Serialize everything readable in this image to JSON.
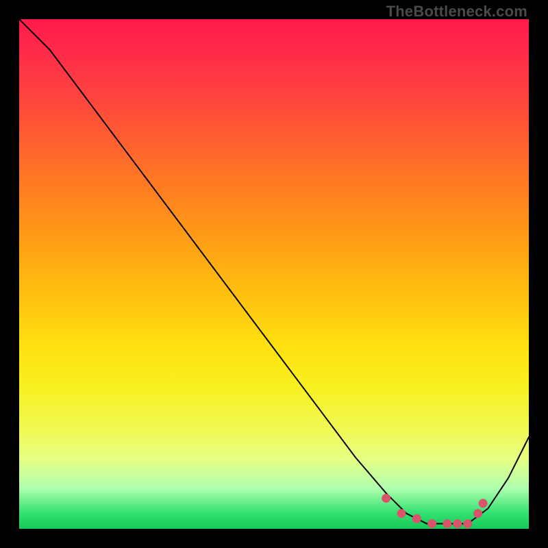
{
  "watermark": "TheBottleneck.com",
  "chart_data": {
    "type": "line",
    "title": "",
    "xlabel": "",
    "ylabel": "",
    "xlim": [
      0,
      100
    ],
    "ylim": [
      0,
      100
    ],
    "series": [
      {
        "name": "curve",
        "x": [
          0,
          6,
          12,
          18,
          24,
          30,
          36,
          42,
          48,
          54,
          60,
          66,
          72,
          76,
          80,
          84,
          88,
          92,
          96,
          100
        ],
        "y": [
          100,
          94,
          86,
          78,
          70,
          62,
          54,
          46,
          38,
          30,
          22,
          14,
          7,
          3,
          1,
          1,
          1,
          4,
          10,
          18
        ]
      }
    ],
    "markers": {
      "name": "highlight",
      "x": [
        72,
        75,
        78,
        81,
        84,
        86,
        88,
        90,
        91
      ],
      "y": [
        6,
        3,
        2,
        1,
        1,
        1,
        1,
        3,
        5
      ]
    }
  },
  "colors": {
    "line": "#000000",
    "marker": "#d9546b"
  }
}
